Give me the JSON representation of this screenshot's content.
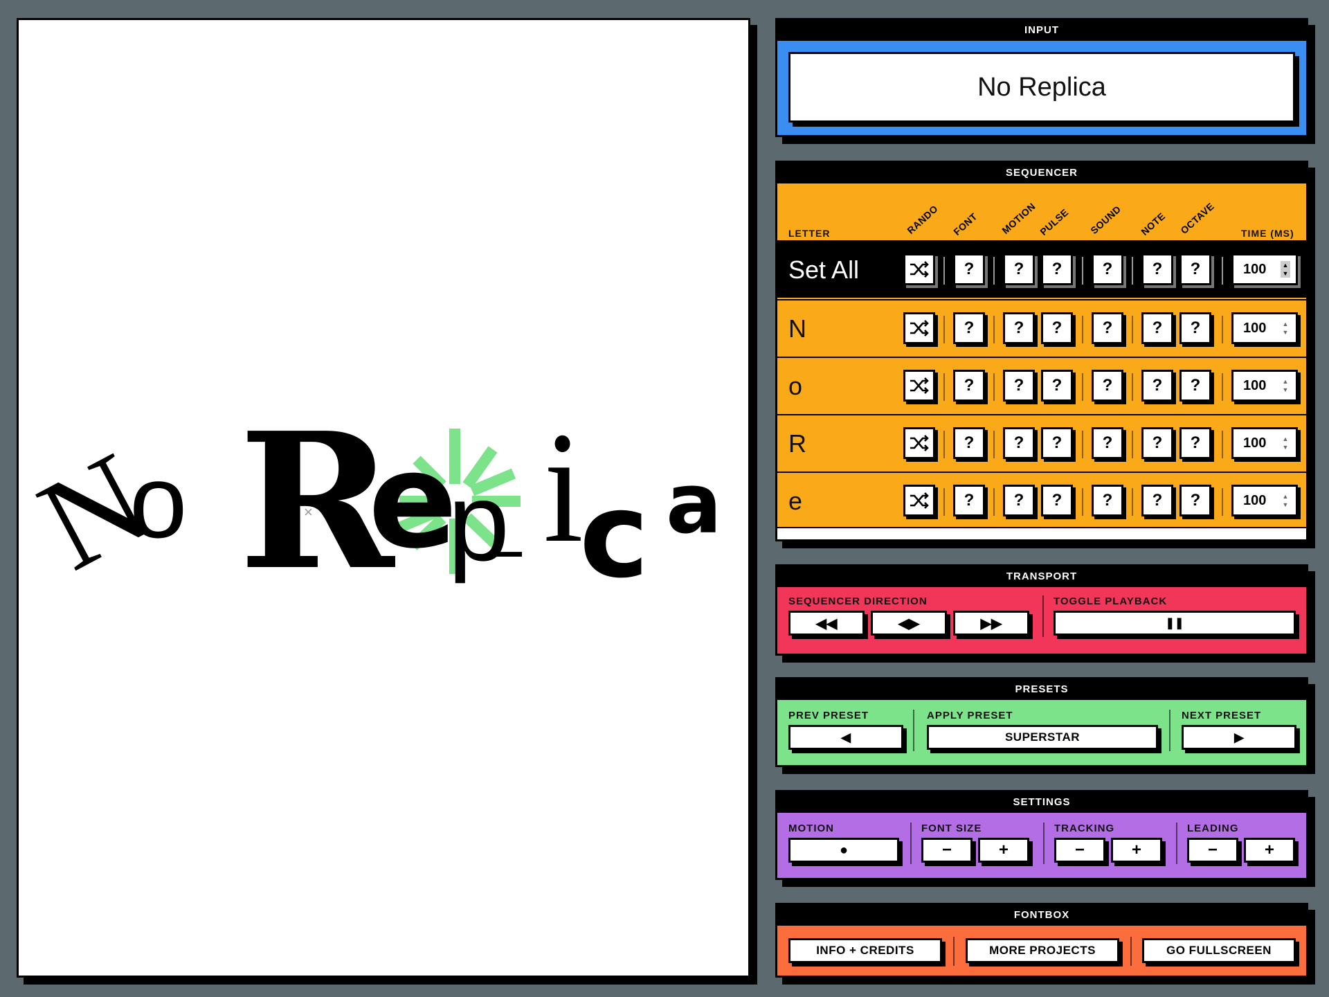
{
  "canvas": {
    "glyphs": [
      "N",
      "o",
      "R",
      "e",
      "p",
      "L",
      "i",
      "c",
      "a"
    ],
    "marks": [
      "×"
    ]
  },
  "input": {
    "title": "INPUT",
    "value": "No Replica"
  },
  "sequencer": {
    "title": "SEQUENCER",
    "columns": [
      "LETTER",
      "RANDO",
      "FONT",
      "MOTION",
      "PULSE",
      "SOUND",
      "NOTE",
      "OCTAVE",
      "TIME (MS)"
    ],
    "set_all": {
      "label": "Set All",
      "time": "100"
    },
    "rows": [
      {
        "letter": "N",
        "time": "100"
      },
      {
        "letter": "o",
        "time": "100"
      },
      {
        "letter": "R",
        "time": "100"
      },
      {
        "letter": "e",
        "time": "100"
      }
    ],
    "unknown_symbol": "?",
    "shuffle_icon": "shuffle-icon"
  },
  "transport": {
    "title": "TRANSPORT",
    "direction_label": "SEQUENCER DIRECTION",
    "playback_label": "TOGGLE PLAYBACK",
    "rewind_symbol": "◀◀",
    "bidirectional_symbol": "◀▶",
    "forward_symbol": "▶▶",
    "pause_symbol": "❚❚"
  },
  "presets": {
    "title": "PRESETS",
    "prev_label": "PREV PRESET",
    "apply_label": "APPLY PRESET",
    "next_label": "NEXT PRESET",
    "prev_symbol": "◀",
    "next_symbol": "▶",
    "current_preset": "SUPERSTAR"
  },
  "settings": {
    "title": "SETTINGS",
    "motion_label": "MOTION",
    "font_size_label": "FONT SIZE",
    "tracking_label": "TRACKING",
    "leading_label": "LEADING",
    "motion_symbol": "●",
    "minus_symbol": "−",
    "plus_symbol": "+"
  },
  "fontbox": {
    "title": "FONTBOX",
    "info_label": "INFO + CREDITS",
    "projects_label": "MORE PROJECTS",
    "fullscreen_label": "GO FULLSCREEN"
  },
  "colors": {
    "background": "#5c6a70",
    "input": "#3a8ef2",
    "sequencer": "#faa918",
    "transport": "#f2365a",
    "presets": "#7de38a",
    "settings": "#b36ee6",
    "fontbox": "#fb6d3c",
    "burst": "#7de38a"
  }
}
